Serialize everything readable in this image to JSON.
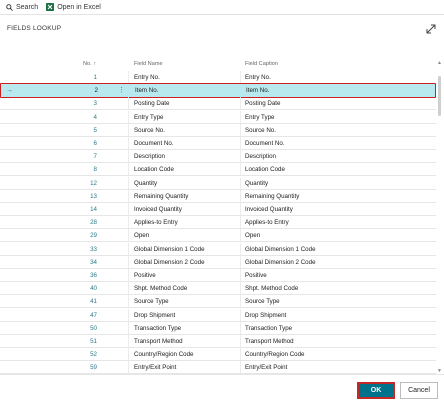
{
  "toolbar": {
    "search_label": "Search",
    "excel_label": "Open in Excel"
  },
  "dialog": {
    "title": "FIELDS LOOKUP"
  },
  "table": {
    "headers": {
      "no": "No. ↑",
      "field_name": "Field Name",
      "field_caption": "Field Caption"
    },
    "rows": [
      {
        "no": "1",
        "name": "Entry No.",
        "caption": "Entry No."
      },
      {
        "no": "2",
        "name": "Item No.",
        "caption": "Item No."
      },
      {
        "no": "3",
        "name": "Posting Date",
        "caption": "Posting Date"
      },
      {
        "no": "4",
        "name": "Entry Type",
        "caption": "Entry Type"
      },
      {
        "no": "5",
        "name": "Source No.",
        "caption": "Source No."
      },
      {
        "no": "6",
        "name": "Document No.",
        "caption": "Document No."
      },
      {
        "no": "7",
        "name": "Description",
        "caption": "Description"
      },
      {
        "no": "8",
        "name": "Location Code",
        "caption": "Location Code"
      },
      {
        "no": "12",
        "name": "Quantity",
        "caption": "Quantity"
      },
      {
        "no": "13",
        "name": "Remaining Quantity",
        "caption": "Remaining Quantity"
      },
      {
        "no": "14",
        "name": "Invoiced Quantity",
        "caption": "Invoiced Quantity"
      },
      {
        "no": "28",
        "name": "Applies-to Entry",
        "caption": "Applies-to Entry"
      },
      {
        "no": "29",
        "name": "Open",
        "caption": "Open"
      },
      {
        "no": "33",
        "name": "Global Dimension 1 Code",
        "caption": "Global Dimension 1 Code"
      },
      {
        "no": "34",
        "name": "Global Dimension 2 Code",
        "caption": "Global Dimension 2 Code"
      },
      {
        "no": "36",
        "name": "Positive",
        "caption": "Positive"
      },
      {
        "no": "40",
        "name": "Shpt. Method Code",
        "caption": "Shpt. Method Code"
      },
      {
        "no": "41",
        "name": "Source Type",
        "caption": "Source Type"
      },
      {
        "no": "47",
        "name": "Drop Shipment",
        "caption": "Drop Shipment"
      },
      {
        "no": "50",
        "name": "Transaction Type",
        "caption": "Transaction Type"
      },
      {
        "no": "51",
        "name": "Transport Method",
        "caption": "Transport Method"
      },
      {
        "no": "52",
        "name": "Country/Region Code",
        "caption": "Country/Region Code"
      },
      {
        "no": "59",
        "name": "Entry/Exit Point",
        "caption": "Entry/Exit Point"
      }
    ],
    "selected_index": 1
  },
  "buttons": {
    "ok": "OK",
    "cancel": "Cancel"
  },
  "colors": {
    "accent": "#00718a",
    "selection": "#b8e9ee",
    "highlight_border": "#cc1f1f"
  }
}
